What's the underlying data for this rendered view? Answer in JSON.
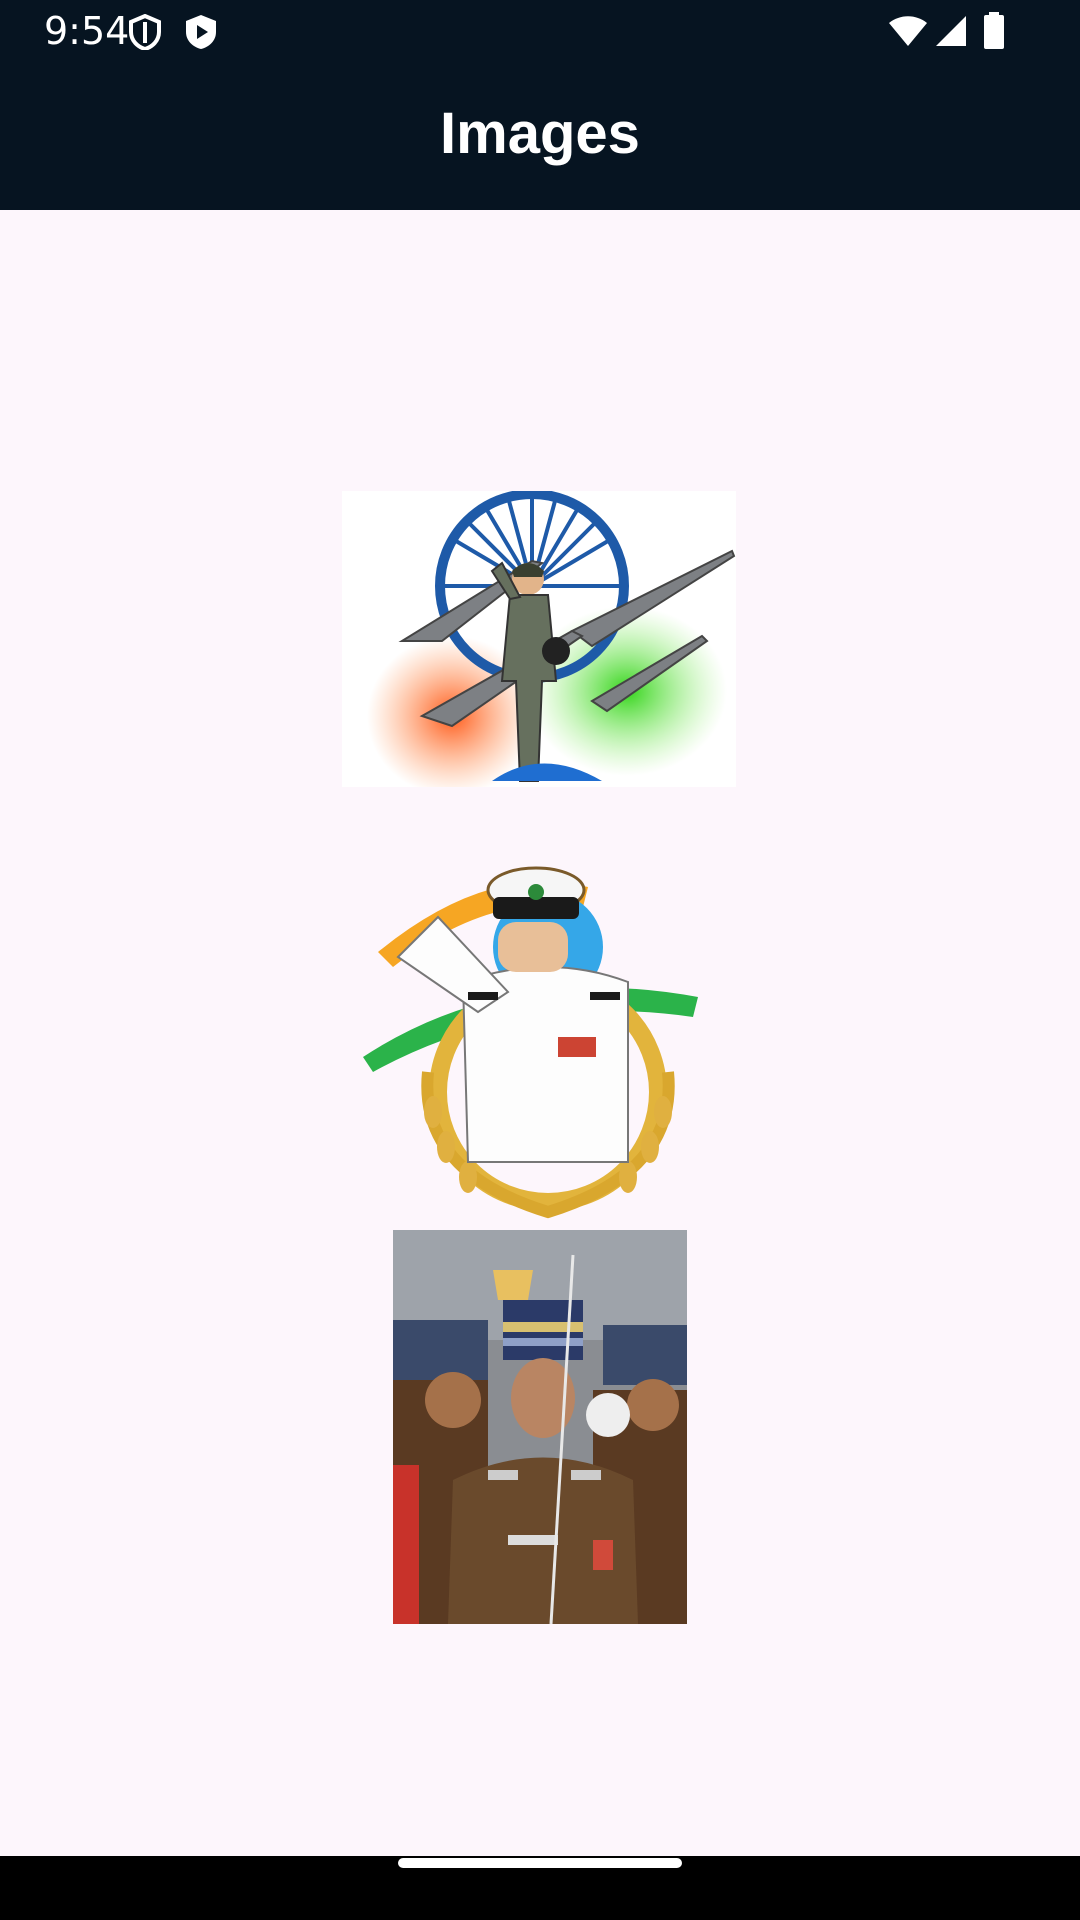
{
  "status_bar": {
    "time": "9:54",
    "left_icons": [
      "shield-icon",
      "play-protect-icon"
    ],
    "right_icons": [
      "wifi-icon",
      "cell-signal-icon",
      "battery-icon"
    ]
  },
  "app_bar": {
    "title": "Images",
    "background": "#061421"
  },
  "images": [
    {
      "name": "air-force-pilot-image",
      "description_icon": "pilot-with-fighter-jets"
    },
    {
      "name": "navy-officer-image",
      "description_icon": "saluting-naval-officer"
    },
    {
      "name": "army-officer-image",
      "description_icon": "army-officer-parade-photo"
    }
  ],
  "colors": {
    "background": "#fdf6fc",
    "saffron": "#ff7a2a",
    "green": "#2fbf3a",
    "chakra_blue": "#1e5aa8"
  }
}
